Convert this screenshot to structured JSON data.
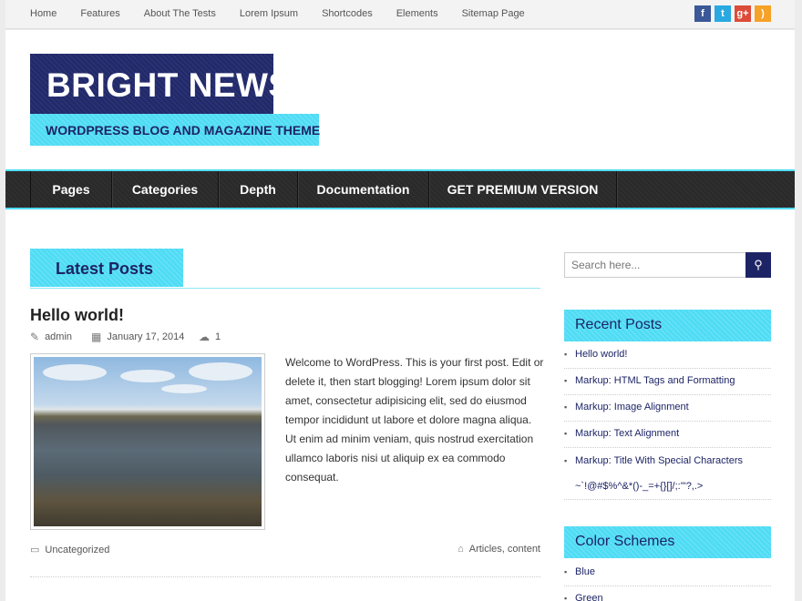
{
  "topnav": [
    "Home",
    "Features",
    "About The Tests",
    "Lorem Ipsum",
    "Shortcodes",
    "Elements",
    "Sitemap Page"
  ],
  "social": [
    {
      "icon": "facebook-icon",
      "glyph": "f"
    },
    {
      "icon": "twitter-icon",
      "glyph": "t"
    },
    {
      "icon": "google-plus-icon",
      "glyph": "g+"
    },
    {
      "icon": "rss-icon",
      "glyph": ")"
    }
  ],
  "site": {
    "title": "BRIGHT NEWS",
    "tagline": "WORDPRESS BLOG AND MAGAZINE THEME"
  },
  "mainnav": [
    "Pages",
    "Categories",
    "Depth",
    "Documentation",
    "GET PREMIUM VERSION"
  ],
  "latest": {
    "heading": "Latest Posts"
  },
  "post": {
    "title": "Hello world!",
    "author": "admin",
    "date": "January 17, 2014",
    "comments": "1",
    "excerpt": "Welcome to WordPress. This is your first post. Edit or delete it, then start blogging! Lorem ipsum dolor sit amet, consectetur adipisicing elit, sed do eiusmod tempor incididunt ut labore et dolore magna aliqua. Ut enim ad minim veniam, quis nostrud exercitation ullamco laboris nisi ut aliquip ex ea commodo consequat.",
    "category": "Uncategorized",
    "tags": "Articles, content"
  },
  "sidebar": {
    "search_placeholder": "Search here...",
    "recent_heading": "Recent Posts",
    "recent": [
      "Hello world!",
      "Markup: HTML Tags and Formatting",
      "Markup: Image Alignment",
      "Markup: Text Alignment",
      "Markup: Title With Special Characters ~`!@#$%^&*()-_=+{}[]/;:'\"?,.>"
    ],
    "schemes_heading": "Color Schemes",
    "schemes": [
      "Blue",
      "Green"
    ]
  },
  "colors": {
    "accent": "#4fdcf5",
    "brand": "#222a6b",
    "nav": "#2a2a2a"
  }
}
